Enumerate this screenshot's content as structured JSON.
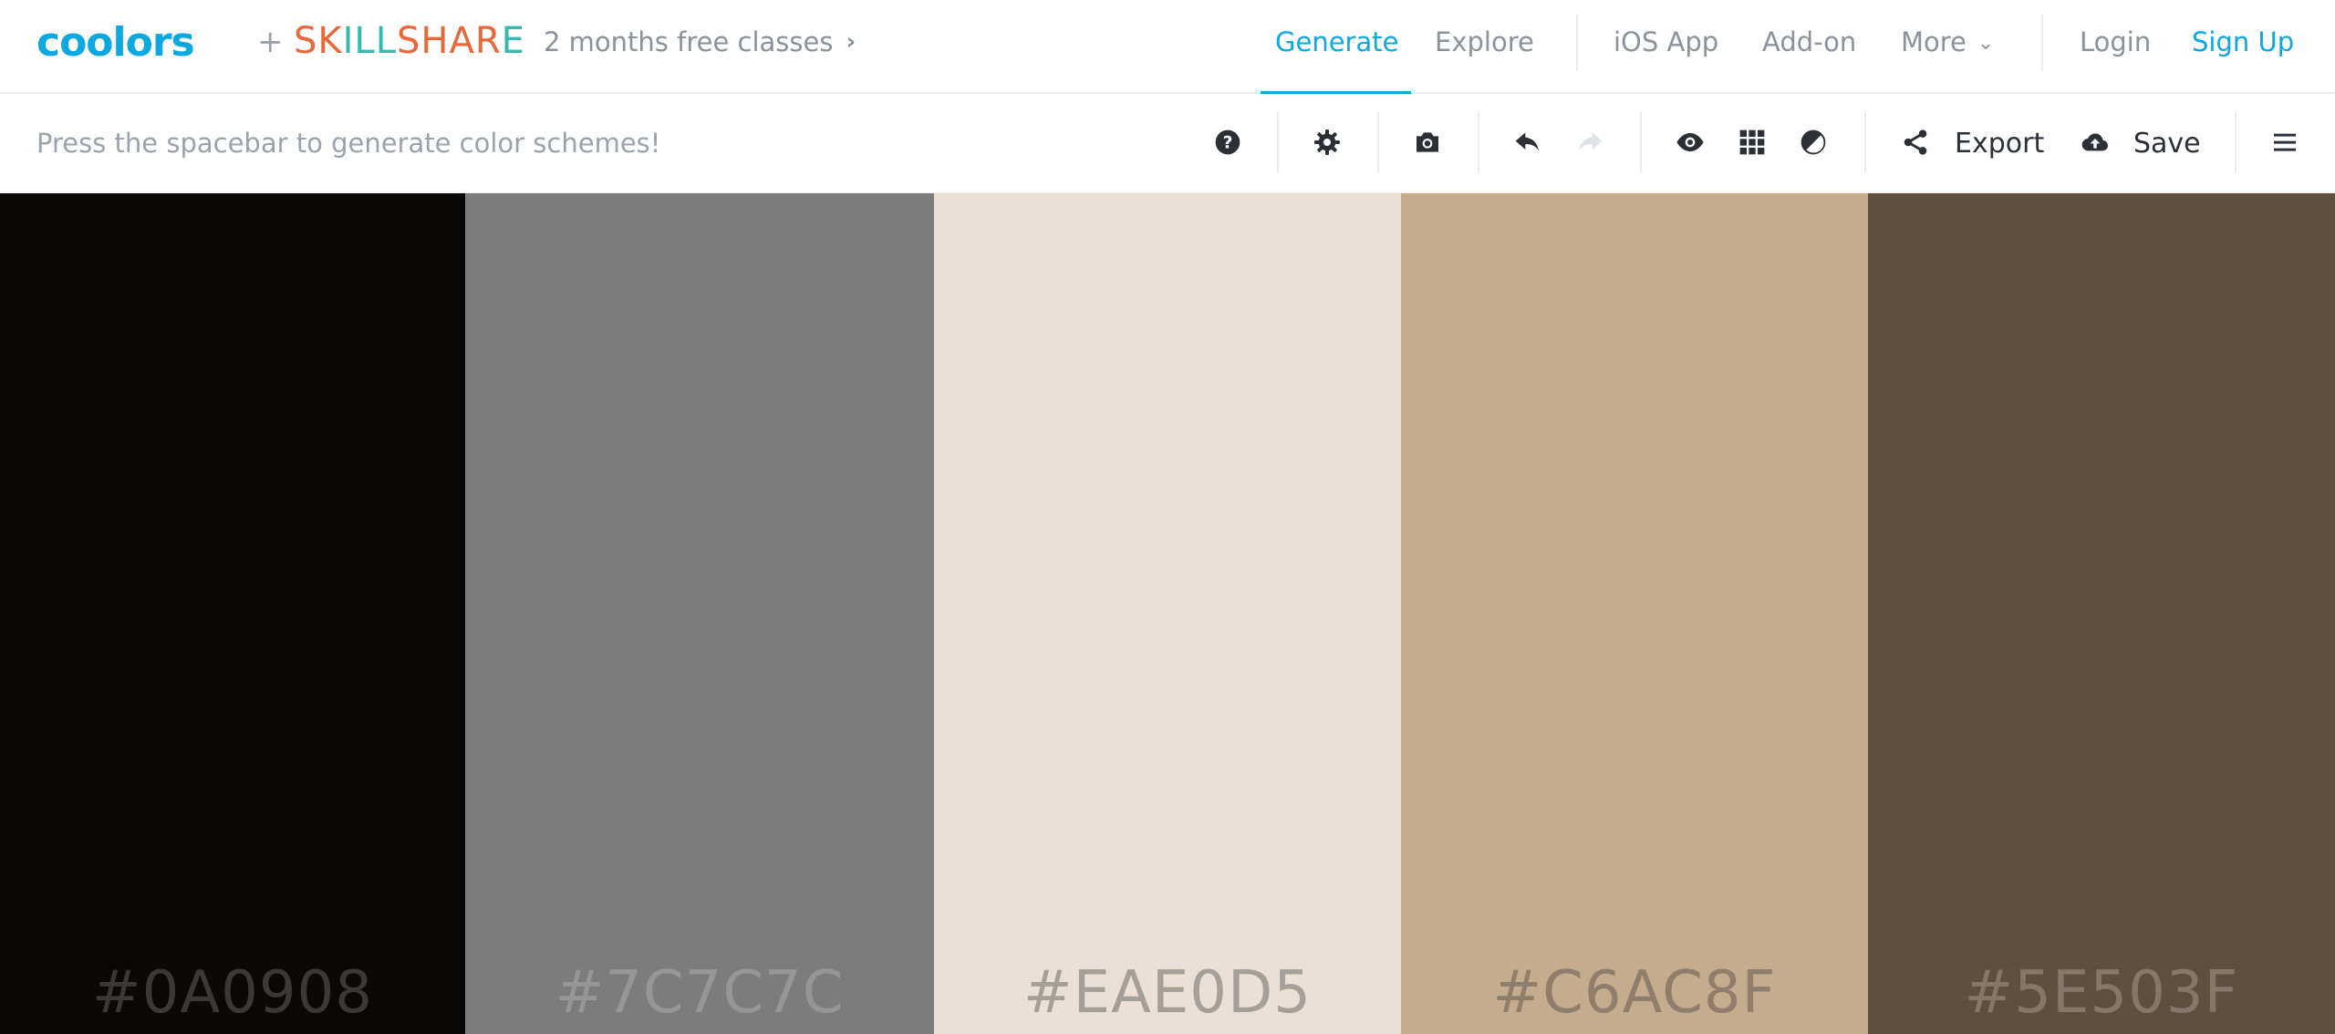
{
  "header": {
    "logo": "coolors",
    "plus": "+",
    "partner_logo": "SKILLSHARE",
    "promo_text": "2 months free classes",
    "nav": {
      "generate": "Generate",
      "explore": "Explore",
      "ios_app": "iOS App",
      "add_on": "Add-on",
      "more": "More",
      "login": "Login",
      "sign_up": "Sign Up"
    }
  },
  "toolbar": {
    "hint": "Press the spacebar to generate color schemes!",
    "export_label": "Export",
    "save_label": "Save",
    "icons": [
      "help-icon",
      "settings-icon",
      "camera-icon",
      "undo-icon",
      "redo-icon",
      "eye-icon",
      "grid-icon",
      "contrast-icon",
      "share-icon",
      "cloud-upload-icon",
      "menu-icon"
    ]
  },
  "palette": {
    "colors": [
      {
        "hex": "#0A0908",
        "label": "#0A0908",
        "label_color": "#3b3836"
      },
      {
        "hex": "#7C7C7C",
        "label": "#7C7C7C",
        "label_color": "#969696"
      },
      {
        "hex": "#EAE0D5",
        "label": "#EAE0D5",
        "label_color": "#a59f99"
      },
      {
        "hex": "#C6AC8F",
        "label": "#C6AC8F",
        "label_color": "#8f7e6b"
      },
      {
        "hex": "#5E503F",
        "label": "#5E503F",
        "label_color": "#857868"
      }
    ]
  },
  "colors": {
    "accent": "#0ea8e0",
    "muted_text": "#8a929c",
    "skillshare_orange": "#e8683a",
    "skillshare_teal": "#35b8b0"
  }
}
